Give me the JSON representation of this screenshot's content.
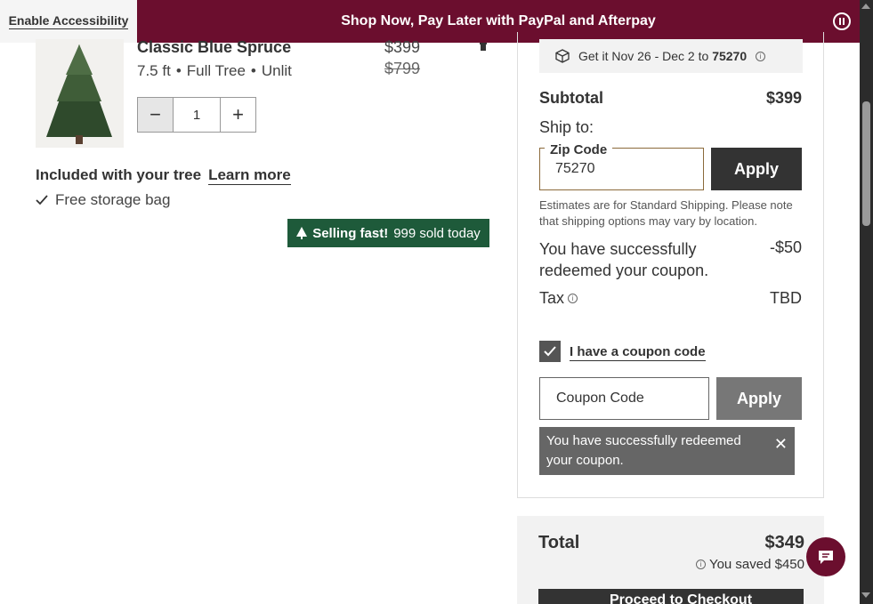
{
  "accessibility": {
    "label": "Enable Accessibility"
  },
  "promo": {
    "text": "Shop Now, Pay Later with PayPal and Afterpay"
  },
  "product": {
    "name": "Classic Blue Spruce",
    "size": "7.5 ft",
    "shape": "Full Tree",
    "lighting": "Unlit",
    "price": "$399",
    "original_price": "$799",
    "quantity": "1",
    "minus_label": "−",
    "plus_label": "+",
    "included_title": "Included with your tree",
    "learn_more": "Learn more",
    "included_items": [
      "Free storage bag"
    ],
    "badge": {
      "strong": "Selling fast!",
      "text": "999 sold today"
    }
  },
  "summary": {
    "delivery_prefix": "Get it Nov 26 - Dec 2 to",
    "delivery_zip": "75270",
    "subtotal_label": "Subtotal",
    "subtotal_value": "$399",
    "ship_to_label": "Ship to:",
    "zip_label": "Zip Code",
    "zip_value": "75270",
    "apply_label": "Apply",
    "estimate_note": "Estimates are for Standard Shipping. Please note that shipping options may vary by location.",
    "coupon_success": "You have successfully redeemed your coupon.",
    "coupon_discount": "-$50",
    "tax_label": "Tax",
    "tax_value": "TBD",
    "coupon_toggle": "I have a coupon code",
    "coupon_placeholder": "Coupon Code",
    "coupon_apply": "Apply",
    "toast_message": "You have successfully redeemed your coupon."
  },
  "total": {
    "label": "Total",
    "value": "$349",
    "saved": "You saved $450",
    "checkout": "Proceed to Checkout"
  },
  "colors": {
    "brand": "#6b0e2e",
    "badge_green": "#1e5a3a",
    "dark": "#333333"
  }
}
